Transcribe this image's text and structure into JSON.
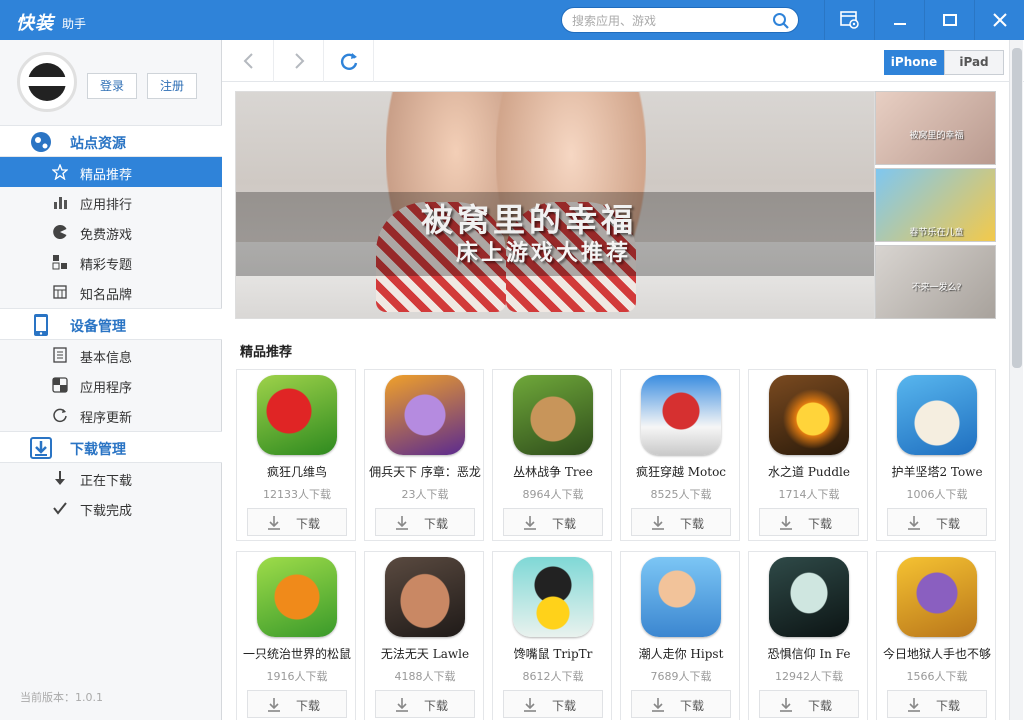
{
  "app": {
    "logo": "快装",
    "logo_sub": "助手"
  },
  "search": {
    "placeholder": "搜索应用、游戏"
  },
  "user": {
    "login": "登录",
    "register": "注册"
  },
  "sidebar": {
    "sections": [
      {
        "title": "站点资源",
        "icon": "site-resource-icon"
      },
      {
        "title": "设备管理",
        "icon": "phone-icon"
      },
      {
        "title": "下载管理",
        "icon": "download-manage-icon"
      }
    ],
    "items": [
      {
        "label": "精品推荐",
        "icon": "star-icon",
        "active": true
      },
      {
        "label": "应用排行",
        "icon": "bar-chart-icon"
      },
      {
        "label": "免费游戏",
        "icon": "pacman-icon"
      },
      {
        "label": "精彩专题",
        "icon": "topic-icon"
      },
      {
        "label": "知名品牌",
        "icon": "brand-icon"
      },
      {
        "label": "基本信息",
        "icon": "info-icon"
      },
      {
        "label": "应用程序",
        "icon": "apps-icon"
      },
      {
        "label": "程序更新",
        "icon": "refresh-icon"
      },
      {
        "label": "正在下载",
        "icon": "downloading-icon"
      },
      {
        "label": "下载完成",
        "icon": "check-icon"
      }
    ],
    "version": "当前版本：1.0.1"
  },
  "toolbar": {
    "device_iphone": "iPhone",
    "device_ipad": "iPad"
  },
  "banner": {
    "line1": "被窝里的幸福",
    "line2": "床上游戏大推荐",
    "thumbs": [
      "被窝里的幸福",
      "春节乐在儿童",
      "不来一发么?"
    ]
  },
  "section_title": "精品推荐",
  "download_label": "下载",
  "apps": [
    {
      "name": "疯狂几维鸟",
      "count": "12133人下载"
    },
    {
      "name": "佣兵天下 序章：恶龙",
      "count": "23人下载"
    },
    {
      "name": "丛林战争  Tree",
      "count": "8964人下载"
    },
    {
      "name": "疯狂穿越  Motoc",
      "count": "8525人下载"
    },
    {
      "name": "水之道  Puddle",
      "count": "1714人下载"
    },
    {
      "name": "护羊坚塔2 Towe",
      "count": "1006人下载"
    },
    {
      "name": "一只统治世界的松鼠",
      "count": "1916人下载"
    },
    {
      "name": "无法无天  Lawle",
      "count": "4188人下载"
    },
    {
      "name": "馋嘴鼠  TripTr",
      "count": "8612人下载"
    },
    {
      "name": "潮人走你  Hipst",
      "count": "7689人下载"
    },
    {
      "name": "恐惧信仰  In Fe",
      "count": "12942人下载"
    },
    {
      "name": "今日地狱人手也不够",
      "count": "1566人下载"
    }
  ]
}
